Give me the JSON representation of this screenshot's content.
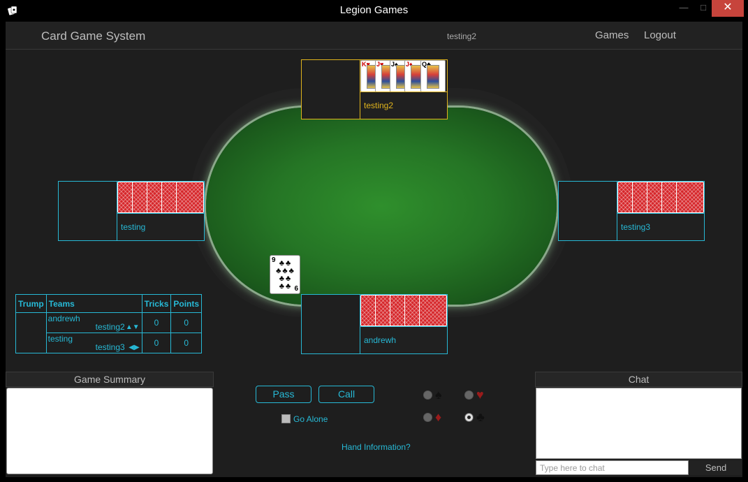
{
  "window": {
    "title": "Legion Games",
    "minimize": "—",
    "maximize": "□",
    "close": "✕",
    "icon": "cards-icon"
  },
  "nav": {
    "brand": "Card Game System",
    "user": "testing2",
    "games": "Games",
    "logout": "Logout"
  },
  "players": {
    "top": {
      "name": "testing2",
      "active": true,
      "cards": [
        "K♥",
        "J♥",
        "J♠",
        "J♦",
        "Q♣"
      ]
    },
    "left": {
      "name": "testing",
      "card_backs": 5
    },
    "right": {
      "name": "testing3",
      "card_backs": 5
    },
    "bottom": {
      "name": "andrewh",
      "card_backs": 5
    }
  },
  "played_card": {
    "rank": "9",
    "suit": "♣",
    "rank_bottom": "6"
  },
  "score": {
    "headers": {
      "trump": "Trump",
      "teams": "Teams",
      "tricks": "Tricks",
      "points": "Points"
    },
    "rows": [
      {
        "p1": "andrewh",
        "p2": "testing2",
        "arrows": "▲▼",
        "tricks": "0",
        "points": "0"
      },
      {
        "p1": "testing",
        "p2": "testing3",
        "arrows": "◀▶",
        "tricks": "0",
        "points": "0"
      }
    ]
  },
  "summary": {
    "title": "Game Summary"
  },
  "controls": {
    "pass": "Pass",
    "call": "Call",
    "go_alone": "Go Alone",
    "hand_info": "Hand Information?"
  },
  "suits": {
    "spades": "♠",
    "hearts": "♥",
    "diamonds": "♦",
    "clubs": "♣",
    "selected": "clubs"
  },
  "chat": {
    "title": "Chat",
    "placeholder": "Type here to chat",
    "send": "Send"
  },
  "colors": {
    "accent": "#27b9d6",
    "active": "#e0b41c",
    "felt": "#2f8f2c",
    "close": "#c7443c"
  }
}
